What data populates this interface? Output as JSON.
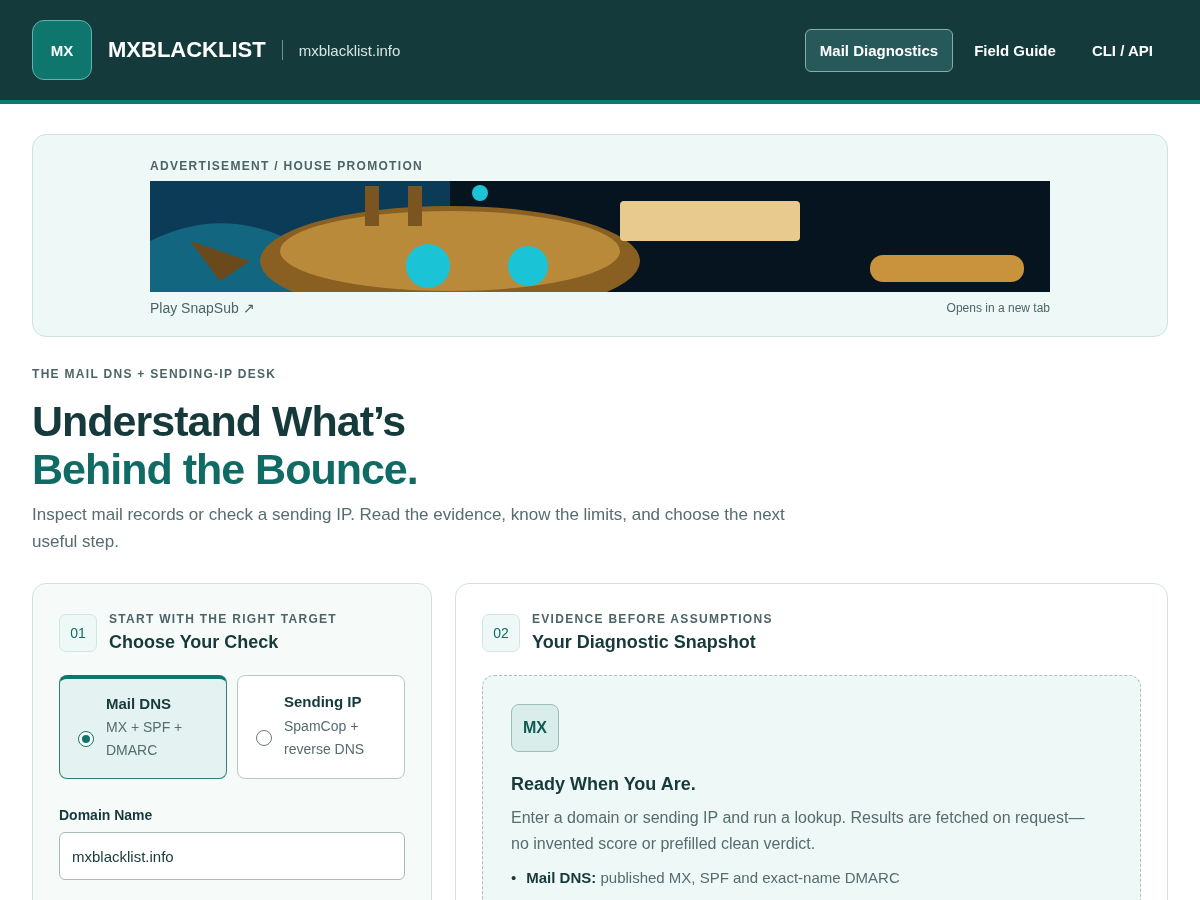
{
  "header": {
    "logo": "MX",
    "brand": "MXBLACKLIST",
    "domain": "mxblacklist.info",
    "nav": [
      {
        "label": "Mail Diagnostics",
        "selected": true
      },
      {
        "label": "Field Guide",
        "selected": false
      },
      {
        "label": "CLI / API",
        "selected": false
      }
    ]
  },
  "ad": {
    "eyebrow": "ADVERTISEMENT / HOUSE PROMOTION",
    "link": "Play SnapSub ↗",
    "note": "Opens in a new tab"
  },
  "hero": {
    "eyebrow": "THE MAIL DNS + SENDING-IP DESK",
    "title_line1": "Understand What’s",
    "title_line2": "Behind the Bounce.",
    "lead": "Inspect mail records or check a sending IP. Read the evidence, know the limits, and choose the next useful step."
  },
  "check_panel": {
    "step": "01",
    "eyebrow": "START WITH THE RIGHT TARGET",
    "title": "Choose Your Check",
    "options": [
      {
        "title": "Mail DNS",
        "detail": "MX + SPF + DMARC",
        "selected": true
      },
      {
        "title": "Sending IP",
        "detail": "SpamCop + reverse DNS",
        "selected": false
      }
    ],
    "field_label": "Domain Name",
    "field_value": "mxblacklist.info"
  },
  "snapshot_panel": {
    "step": "02",
    "eyebrow": "EVIDENCE BEFORE ASSUMPTIONS",
    "title": "Your Diagnostic Snapshot",
    "badge": "MX",
    "heading": "Ready When You Are.",
    "text": "Enter a domain or sending IP and run a lookup. Results are fetched on request—no invented score or prefilled clean verdict.",
    "bullets": [
      {
        "marker": "•",
        "text": "**Mail DNS:** published MX, SPF and exact-name DMARC"
      }
    ]
  }
}
